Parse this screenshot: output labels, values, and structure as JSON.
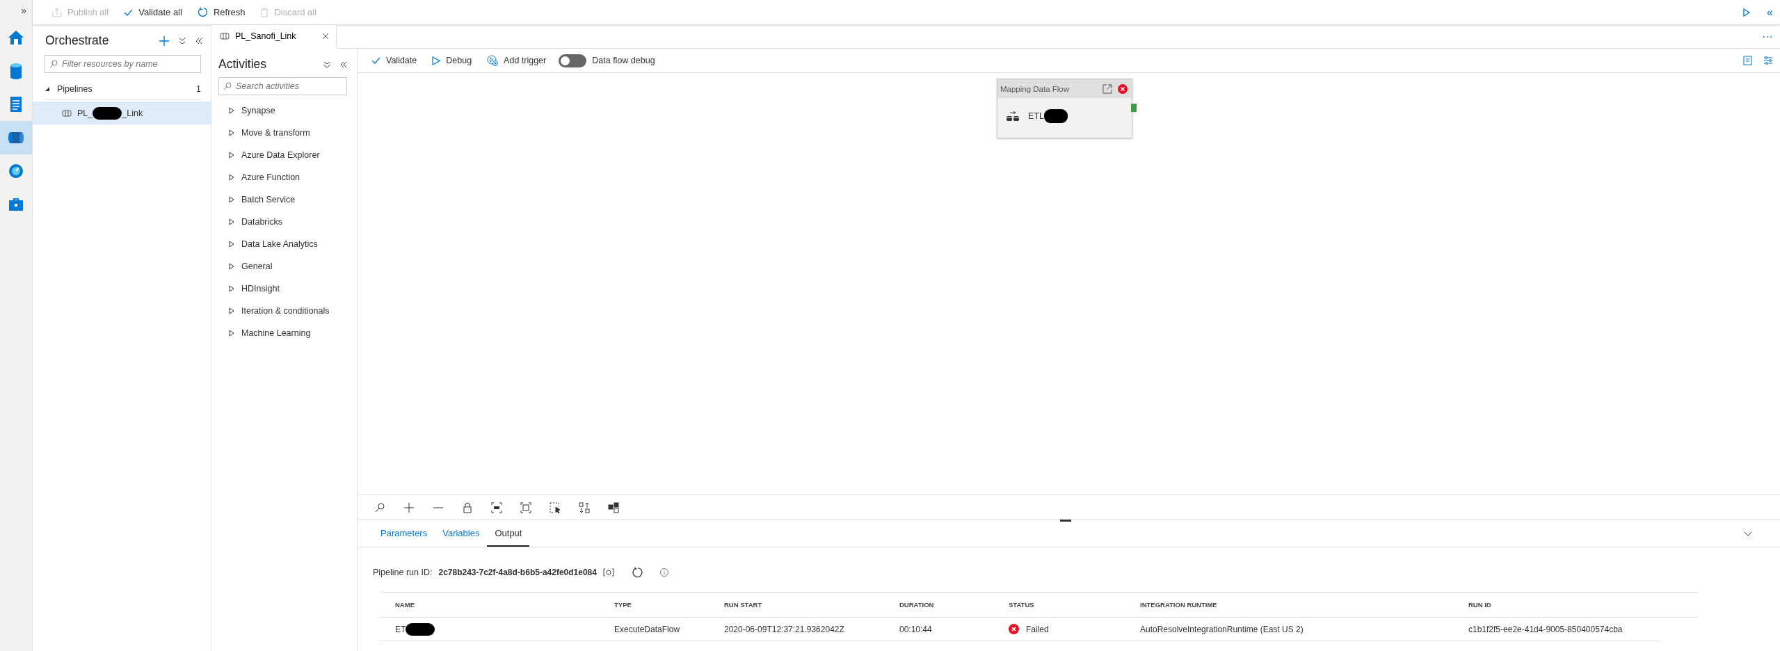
{
  "nav": {
    "expand_glyph": "»",
    "items": [
      {
        "kind": "home",
        "selected": false
      },
      {
        "kind": "data",
        "selected": false
      },
      {
        "kind": "develop",
        "selected": false
      },
      {
        "kind": "orchestrate",
        "selected": true
      },
      {
        "kind": "monitor",
        "selected": false
      },
      {
        "kind": "manage",
        "selected": false
      }
    ]
  },
  "top_bar": {
    "actions": [
      {
        "kind": "publish",
        "label": "Publish all",
        "disabled": true
      },
      {
        "kind": "validate",
        "label": "Validate all",
        "disabled": false
      },
      {
        "kind": "refresh",
        "label": "Refresh",
        "disabled": false
      },
      {
        "kind": "discard",
        "label": "Discard all",
        "disabled": true
      }
    ],
    "collapse_glyph": "«",
    "more_glyph": "···"
  },
  "orchestrate": {
    "title": "Orchestrate",
    "search": {
      "placeholder": "Filter resources by name"
    },
    "sections": [
      {
        "label": "Pipelines",
        "count": "1",
        "expanded": true,
        "children": [
          {
            "name_start": "PL_",
            "name_end": "_Link",
            "redacted": true,
            "selected": true
          }
        ]
      }
    ]
  },
  "tabs": [
    {
      "label": "PL_Sanofi_Link",
      "selected": true
    }
  ],
  "activities": {
    "title": "Activities",
    "search": {
      "placeholder": "Search activities"
    },
    "groups": [
      {
        "label": "Synapse",
        "expanded": false
      },
      {
        "label": "Move & transform",
        "expanded": false
      },
      {
        "label": "Azure Data Explorer",
        "expanded": false
      },
      {
        "label": "Azure Function",
        "expanded": false
      },
      {
        "label": "Batch Service",
        "expanded": false
      },
      {
        "label": "Databricks",
        "expanded": false
      },
      {
        "label": "Data Lake Analytics",
        "expanded": false
      },
      {
        "label": "General",
        "expanded": false
      },
      {
        "label": "HDInsight",
        "expanded": false
      },
      {
        "label": "Iteration & conditionals",
        "expanded": false
      },
      {
        "label": "Machine Learning",
        "expanded": false
      }
    ]
  },
  "toolbar": {
    "actions": [
      {
        "kind": "validate",
        "label": "Validate"
      },
      {
        "kind": "debug",
        "label": "Debug"
      },
      {
        "kind": "trigger",
        "label": "Add trigger"
      }
    ],
    "toggle": {
      "label": "Data flow debug",
      "on": false
    }
  },
  "canvas": {
    "activity": {
      "header": "Mapping Data Flow",
      "name": "ETL",
      "redacted": true,
      "error": true
    },
    "tools": [
      {
        "kind": "search"
      },
      {
        "kind": "zoom-in"
      },
      {
        "kind": "zoom-out"
      },
      {
        "kind": "lock"
      },
      {
        "kind": "zoom-100"
      },
      {
        "kind": "fit"
      },
      {
        "kind": "select"
      },
      {
        "kind": "align"
      },
      {
        "kind": "layout"
      }
    ]
  },
  "bottom": {
    "tabs": [
      {
        "label": "Parameters",
        "selected": false
      },
      {
        "label": "Variables",
        "selected": false
      },
      {
        "label": "Output",
        "selected": true
      }
    ],
    "run": {
      "label": "Pipeline run ID:",
      "value": "2c78b243-7c2f-4a8d-b6b5-a42fe0d1e084"
    },
    "table": {
      "columns": [
        "NAME",
        "TYPE",
        "RUN START",
        "DURATION",
        "STATUS",
        "INTEGRATION RUNTIME",
        "RUN ID"
      ],
      "rows": [
        {
          "name": "ET",
          "redacted": true,
          "type": "ExecuteDataFlow",
          "run_start": "2020-06-09T12:37:21.9362042Z",
          "duration": "00:10:44",
          "status": "Failed",
          "failed": true,
          "integration_runtime": "AutoResolveIntegrationRuntime (East US 2)",
          "run_id": "c1b1f2f5-ee2e-41d4-9005-850400574cba"
        }
      ]
    }
  }
}
